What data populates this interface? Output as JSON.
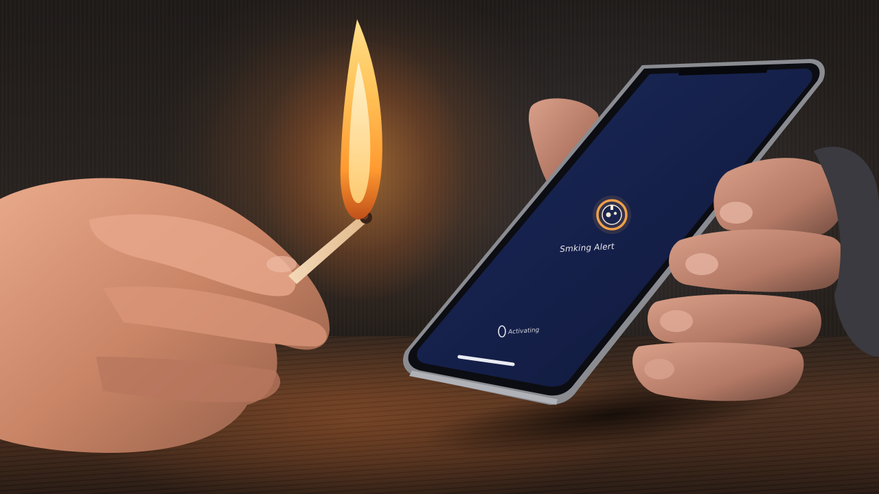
{
  "scene": {
    "description_label": "",
    "colors": {
      "flame": "#ffb347",
      "screen": "#16214a",
      "accent_ring": "#f0a04a",
      "table": "#4a2e1e"
    }
  },
  "phone": {
    "alert_icon": "alert-badge-icon",
    "alert_title": "Smking Alert",
    "status_icon": "loading-ring-icon",
    "status_text": "Activating"
  }
}
